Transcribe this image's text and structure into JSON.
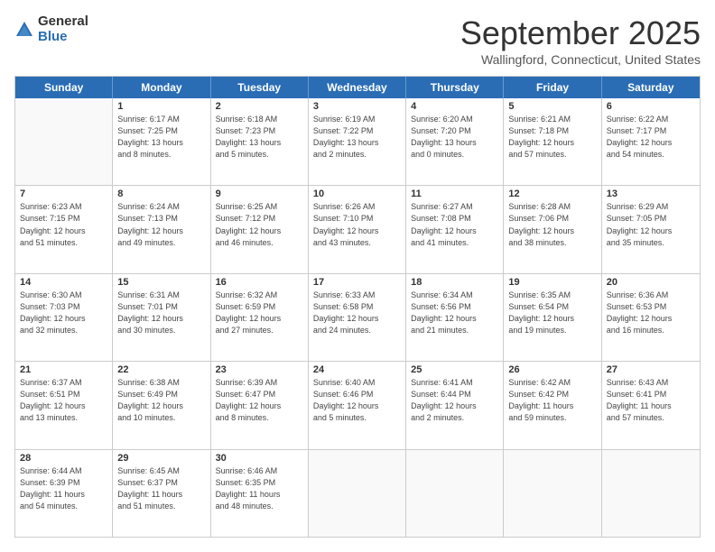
{
  "logo": {
    "general": "General",
    "blue": "Blue"
  },
  "title": {
    "month": "September 2025",
    "location": "Wallingford, Connecticut, United States"
  },
  "calendar": {
    "headers": [
      "Sunday",
      "Monday",
      "Tuesday",
      "Wednesday",
      "Thursday",
      "Friday",
      "Saturday"
    ],
    "weeks": [
      [
        {
          "day": "",
          "info": ""
        },
        {
          "day": "1",
          "info": "Sunrise: 6:17 AM\nSunset: 7:25 PM\nDaylight: 13 hours\nand 8 minutes."
        },
        {
          "day": "2",
          "info": "Sunrise: 6:18 AM\nSunset: 7:23 PM\nDaylight: 13 hours\nand 5 minutes."
        },
        {
          "day": "3",
          "info": "Sunrise: 6:19 AM\nSunset: 7:22 PM\nDaylight: 13 hours\nand 2 minutes."
        },
        {
          "day": "4",
          "info": "Sunrise: 6:20 AM\nSunset: 7:20 PM\nDaylight: 13 hours\nand 0 minutes."
        },
        {
          "day": "5",
          "info": "Sunrise: 6:21 AM\nSunset: 7:18 PM\nDaylight: 12 hours\nand 57 minutes."
        },
        {
          "day": "6",
          "info": "Sunrise: 6:22 AM\nSunset: 7:17 PM\nDaylight: 12 hours\nand 54 minutes."
        }
      ],
      [
        {
          "day": "7",
          "info": "Sunrise: 6:23 AM\nSunset: 7:15 PM\nDaylight: 12 hours\nand 51 minutes."
        },
        {
          "day": "8",
          "info": "Sunrise: 6:24 AM\nSunset: 7:13 PM\nDaylight: 12 hours\nand 49 minutes."
        },
        {
          "day": "9",
          "info": "Sunrise: 6:25 AM\nSunset: 7:12 PM\nDaylight: 12 hours\nand 46 minutes."
        },
        {
          "day": "10",
          "info": "Sunrise: 6:26 AM\nSunset: 7:10 PM\nDaylight: 12 hours\nand 43 minutes."
        },
        {
          "day": "11",
          "info": "Sunrise: 6:27 AM\nSunset: 7:08 PM\nDaylight: 12 hours\nand 41 minutes."
        },
        {
          "day": "12",
          "info": "Sunrise: 6:28 AM\nSunset: 7:06 PM\nDaylight: 12 hours\nand 38 minutes."
        },
        {
          "day": "13",
          "info": "Sunrise: 6:29 AM\nSunset: 7:05 PM\nDaylight: 12 hours\nand 35 minutes."
        }
      ],
      [
        {
          "day": "14",
          "info": "Sunrise: 6:30 AM\nSunset: 7:03 PM\nDaylight: 12 hours\nand 32 minutes."
        },
        {
          "day": "15",
          "info": "Sunrise: 6:31 AM\nSunset: 7:01 PM\nDaylight: 12 hours\nand 30 minutes."
        },
        {
          "day": "16",
          "info": "Sunrise: 6:32 AM\nSunset: 6:59 PM\nDaylight: 12 hours\nand 27 minutes."
        },
        {
          "day": "17",
          "info": "Sunrise: 6:33 AM\nSunset: 6:58 PM\nDaylight: 12 hours\nand 24 minutes."
        },
        {
          "day": "18",
          "info": "Sunrise: 6:34 AM\nSunset: 6:56 PM\nDaylight: 12 hours\nand 21 minutes."
        },
        {
          "day": "19",
          "info": "Sunrise: 6:35 AM\nSunset: 6:54 PM\nDaylight: 12 hours\nand 19 minutes."
        },
        {
          "day": "20",
          "info": "Sunrise: 6:36 AM\nSunset: 6:53 PM\nDaylight: 12 hours\nand 16 minutes."
        }
      ],
      [
        {
          "day": "21",
          "info": "Sunrise: 6:37 AM\nSunset: 6:51 PM\nDaylight: 12 hours\nand 13 minutes."
        },
        {
          "day": "22",
          "info": "Sunrise: 6:38 AM\nSunset: 6:49 PM\nDaylight: 12 hours\nand 10 minutes."
        },
        {
          "day": "23",
          "info": "Sunrise: 6:39 AM\nSunset: 6:47 PM\nDaylight: 12 hours\nand 8 minutes."
        },
        {
          "day": "24",
          "info": "Sunrise: 6:40 AM\nSunset: 6:46 PM\nDaylight: 12 hours\nand 5 minutes."
        },
        {
          "day": "25",
          "info": "Sunrise: 6:41 AM\nSunset: 6:44 PM\nDaylight: 12 hours\nand 2 minutes."
        },
        {
          "day": "26",
          "info": "Sunrise: 6:42 AM\nSunset: 6:42 PM\nDaylight: 11 hours\nand 59 minutes."
        },
        {
          "day": "27",
          "info": "Sunrise: 6:43 AM\nSunset: 6:41 PM\nDaylight: 11 hours\nand 57 minutes."
        }
      ],
      [
        {
          "day": "28",
          "info": "Sunrise: 6:44 AM\nSunset: 6:39 PM\nDaylight: 11 hours\nand 54 minutes."
        },
        {
          "day": "29",
          "info": "Sunrise: 6:45 AM\nSunset: 6:37 PM\nDaylight: 11 hours\nand 51 minutes."
        },
        {
          "day": "30",
          "info": "Sunrise: 6:46 AM\nSunset: 6:35 PM\nDaylight: 11 hours\nand 48 minutes."
        },
        {
          "day": "",
          "info": ""
        },
        {
          "day": "",
          "info": ""
        },
        {
          "day": "",
          "info": ""
        },
        {
          "day": "",
          "info": ""
        }
      ]
    ]
  }
}
